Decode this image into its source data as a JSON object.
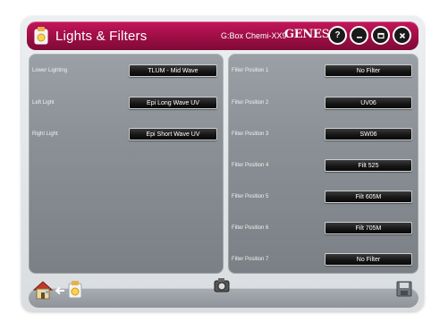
{
  "header": {
    "title": "Lights & Filters",
    "device": "G:Box Chemi-XX9",
    "brand_bold": "GENE",
    "brand_light": "Sys",
    "help_label": "?"
  },
  "lighting": [
    {
      "label": "Lower Lighting",
      "value": "TLUM - Mid Wave"
    },
    {
      "label": "Left Light",
      "value": "Epi Long Wave UV"
    },
    {
      "label": "Right Light",
      "value": "Epi Short Wave UV"
    }
  ],
  "filters": [
    {
      "label": "Filter Position 1",
      "value": "No Filter"
    },
    {
      "label": "Filter Position 2",
      "value": "UV06"
    },
    {
      "label": "Filter Position 3",
      "value": "SW06"
    },
    {
      "label": "Filter Position 4",
      "value": "Filt 525"
    },
    {
      "label": "Filter Position 5",
      "value": "Filt 605M"
    },
    {
      "label": "Filter Position 6",
      "value": "Filt 705M"
    },
    {
      "label": "Filter Position 7",
      "value": "No Filter"
    }
  ],
  "colors": {
    "titlebar": "#a40f48",
    "panel": "#8a9095",
    "button": "#141414"
  },
  "icons": {
    "app": "lights-filters-icon",
    "home": "home-icon",
    "arrow": "back-arrow-icon",
    "current": "lights-filters-icon",
    "center": "camera-icon",
    "save": "save-icon"
  }
}
